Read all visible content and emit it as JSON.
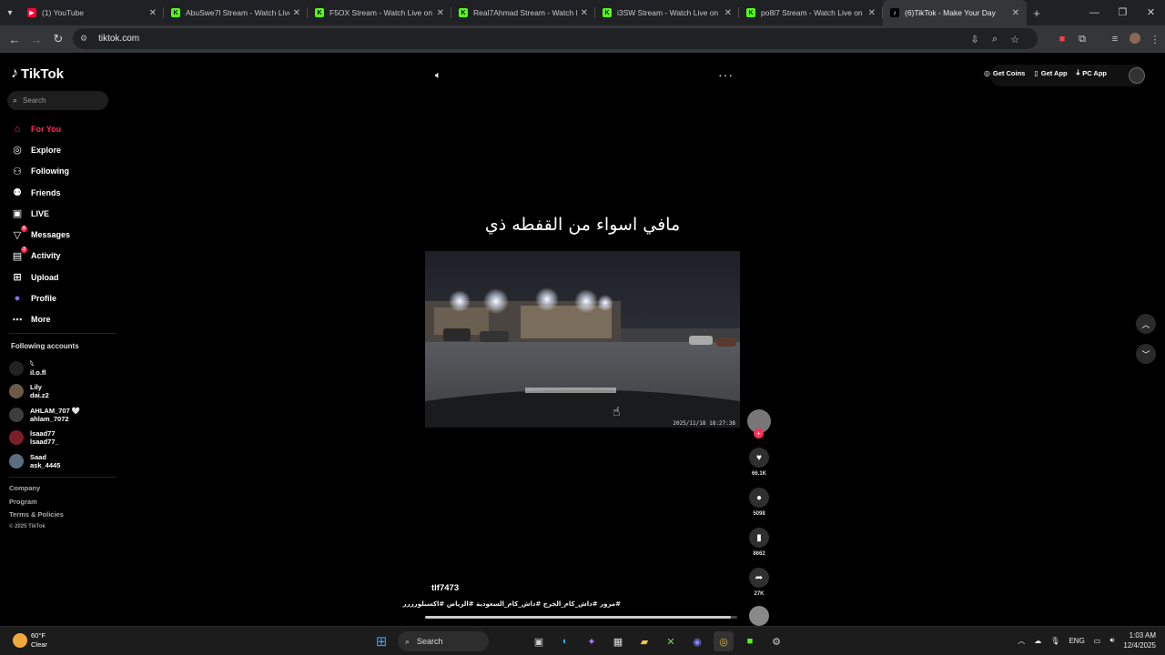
{
  "browser": {
    "tabs": [
      {
        "title": "(1) YouTube",
        "icon": "youtube-icon",
        "color": "#ff0033"
      },
      {
        "title": "AbuSwe7l Stream - Watch Live",
        "icon": "kick-icon",
        "color": "#53fc18"
      },
      {
        "title": "F5OX Stream - Watch Live on K",
        "icon": "kick-icon",
        "color": "#53fc18"
      },
      {
        "title": "Real7Ahmad Stream - Watch Li",
        "icon": "kick-icon",
        "color": "#53fc18"
      },
      {
        "title": "i3SW Stream - Watch Live on K",
        "icon": "kick-icon",
        "color": "#53fc18"
      },
      {
        "title": "po8l7 Stream - Watch Live on K",
        "icon": "kick-icon",
        "color": "#53fc18"
      },
      {
        "title": "(6)TikTok - Make Your Day",
        "icon": "tiktok-icon",
        "color": "#ffffff",
        "active": true
      }
    ],
    "url": "tiktok.com"
  },
  "sidebar": {
    "logo": "TikTok",
    "search_placeholder": "Search",
    "menu": [
      {
        "label": "For You",
        "icon": "home-icon",
        "active": true
      },
      {
        "label": "Explore",
        "icon": "compass-icon"
      },
      {
        "label": "Following",
        "icon": "following-icon"
      },
      {
        "label": "Friends",
        "icon": "friends-icon"
      },
      {
        "label": "LIVE",
        "icon": "live-icon"
      },
      {
        "label": "Messages",
        "icon": "messages-icon",
        "badge": "6"
      },
      {
        "label": "Activity",
        "icon": "activity-icon",
        "badge": "2"
      },
      {
        "label": "Upload",
        "icon": "upload-icon"
      },
      {
        "label": "Profile",
        "icon": "profile-icon"
      },
      {
        "label": "More",
        "icon": "more-icon"
      }
    ],
    "following_title": "Following accounts",
    "following": [
      {
        "name": "𓆩",
        "handle": "il.o.fl"
      },
      {
        "name": "Lily",
        "handle": "dai.z2"
      },
      {
        "name": "AHLAM_707 🤍",
        "handle": "ahlam_7072"
      },
      {
        "name": "lsaad77",
        "handle": "lsaad77_"
      },
      {
        "name": "Saad",
        "handle": "ask_4445"
      }
    ],
    "footer": [
      "Company",
      "Program",
      "Terms & Policies"
    ],
    "copyright": "© 2025 TikTok"
  },
  "header": {
    "get_coins": "Get Coins",
    "get_app": "Get App",
    "pc_app": "PC App"
  },
  "video": {
    "caption": "مافي اسواء من القفطه ذي",
    "timestamp": "2025/11/18 18:27:38",
    "username": "tlf7473",
    "hashtags": "#مرور #داش_كام_الخرج #داش_كام_السعودية #الرياض #اكسبلورررر",
    "progress": 0.98
  },
  "actions": {
    "likes": "66.1K",
    "comments": "5098",
    "saves": "8662",
    "shares": "27K"
  },
  "taskbar": {
    "temp": "60°F",
    "condition": "Clear",
    "search": "Search",
    "lang": "ENG",
    "time": "1:03 AM",
    "date": "12/4/2025"
  }
}
